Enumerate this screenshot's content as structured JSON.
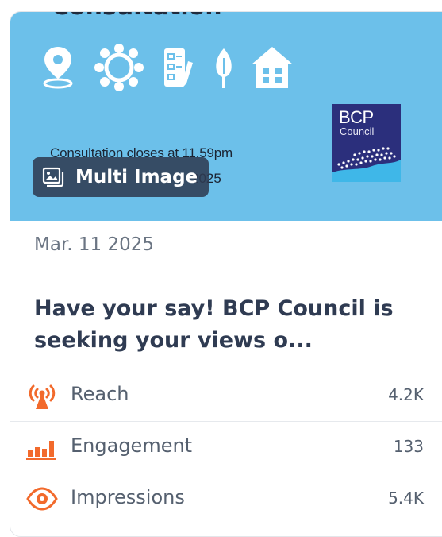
{
  "post": {
    "banner": {
      "heading": "Consultation",
      "closes_line": "Consultation closes at 11.59pm",
      "closes_date": "2025",
      "logo_title": "BCP",
      "logo_subtitle": "Council",
      "banner_color": "#6cc0ea",
      "icons": [
        "location-pin-icon",
        "community-icon",
        "survey-form-icon",
        "tree-icon",
        "house-icon"
      ]
    },
    "badge": {
      "icon": "image-gallery-icon",
      "label": "Multi Image"
    },
    "date": "Mar. 11 2025",
    "title_line1": "Have your say! BCP Council is",
    "title_line2": "seeking your views o...",
    "metrics": [
      {
        "icon": "broadcast-tower-icon",
        "label": "Reach",
        "value": "4.2K"
      },
      {
        "icon": "bar-chart-icon",
        "label": "Engagement",
        "value": "133"
      },
      {
        "icon": "eye-icon",
        "label": "Impressions",
        "value": "5.4K"
      }
    ],
    "accent_color": "#f26a2c",
    "text_color": "#2f3b52"
  }
}
